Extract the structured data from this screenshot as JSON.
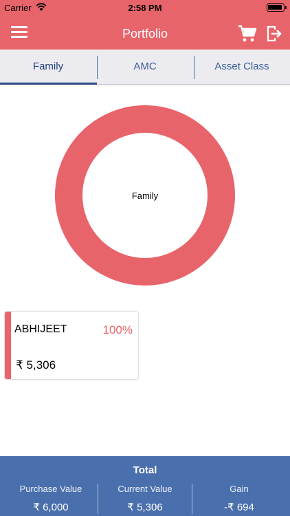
{
  "status_bar": {
    "carrier": "Carrier",
    "time": "2:58 PM"
  },
  "nav": {
    "title": "Portfolio",
    "menu_icon": "hamburger-menu-icon",
    "cart_icon": "cart-icon",
    "logout_icon": "logout-icon"
  },
  "tabs": [
    {
      "label": "Family",
      "active": true
    },
    {
      "label": "AMC",
      "active": false
    },
    {
      "label": "Asset Class",
      "active": false
    }
  ],
  "chart_data": {
    "type": "pie",
    "center_label": "Family",
    "categories": [
      "ABHIJEET"
    ],
    "values": [
      100
    ],
    "colors": [
      "#e8646b"
    ]
  },
  "members": [
    {
      "name": "ABHIJEET",
      "percent": "100%",
      "amount": "₹ 5,306"
    }
  ],
  "totals": {
    "title": "Total",
    "purchase_label": "Purchase Value",
    "purchase_value": "₹ 6,000",
    "current_label": "Current Value",
    "current_value": "₹ 5,306",
    "gain_label": "Gain",
    "gain_value": "-₹ 694"
  },
  "colors": {
    "accent": "#e8646b",
    "footer": "#4a6fad",
    "tab_text": "#3b5c9a"
  }
}
